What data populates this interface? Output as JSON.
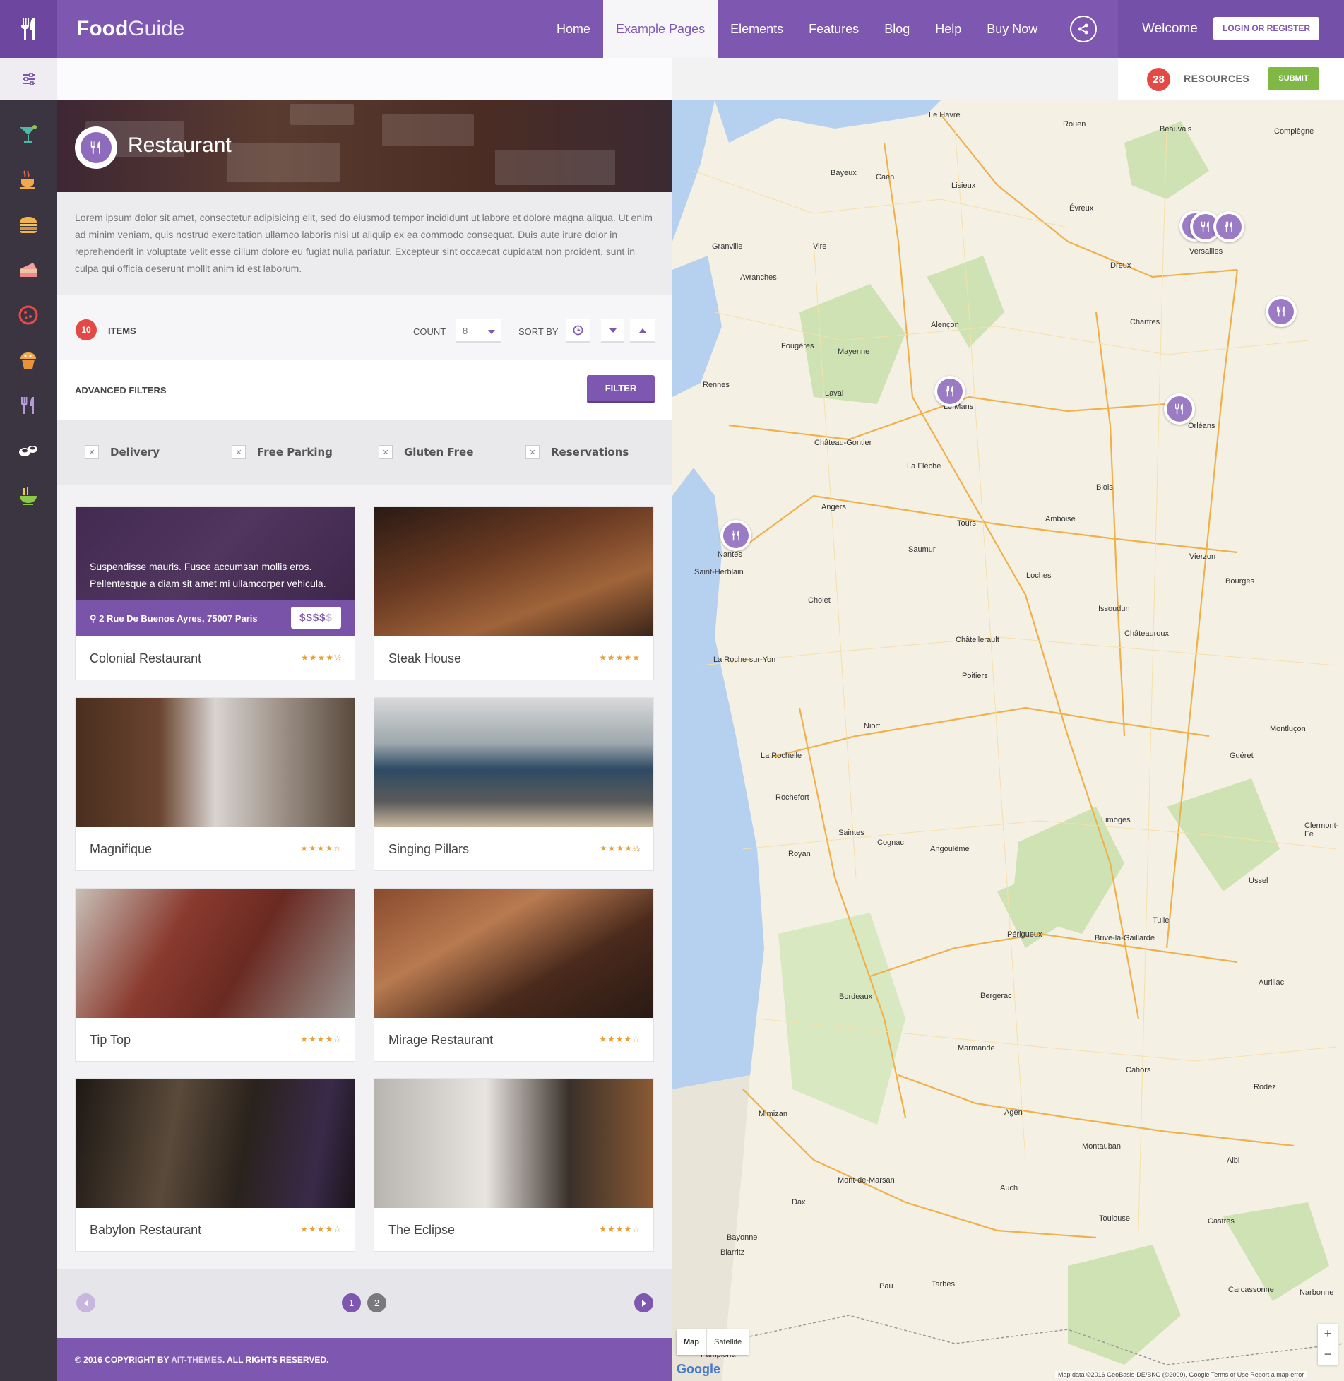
{
  "header": {
    "brand_bold": "Food",
    "brand_light": "Guide",
    "nav": [
      "Home",
      "Example Pages",
      "Elements",
      "Features",
      "Blog",
      "Help",
      "Buy Now"
    ],
    "active_nav": "Example Pages",
    "welcome": "Welcome",
    "login": "LOGIN OR REGISTER",
    "accent": "#7e57b0"
  },
  "resources": {
    "count": "28",
    "label": "RESOURCES",
    "submit": "SUBMIT"
  },
  "sidebar": {
    "icons": [
      "cocktail-icon",
      "coffee-icon",
      "burger-icon",
      "cake-icon",
      "pizza-icon",
      "muffin-icon",
      "restaurant-icon",
      "sushi-icon",
      "noodle-bowl-icon"
    ]
  },
  "hero": {
    "title": "Restaurant"
  },
  "description": "Lorem ipsum dolor sit amet, consectetur adipisicing elit, sed do eiusmod tempor incididunt ut labore et dolore magna aliqua. Ut enim ad minim veniam, quis nostrud exercitation ullamco laboris nisi ut aliquip ex ea commodo consequat. Duis aute irure dolor in reprehenderit in voluptate velit esse cillum dolore eu fugiat nulla pariatur. Excepteur sint occaecat cupidatat non proident, sunt in culpa qui officia deserunt mollit anim id est laborum.",
  "toolbar": {
    "items_count": "10",
    "items_label": "ITEMS",
    "count_label": "COUNT",
    "count_value": "8",
    "sort_label": "SORT BY"
  },
  "filters": {
    "advanced_label": "ADVANCED FILTERS",
    "filter_button": "FILTER",
    "options": [
      "Delivery",
      "Free Parking",
      "Gluten Free",
      "Reservations"
    ]
  },
  "featured": {
    "excerpt": "Suspendisse mauris. Fusce accumsan mollis eros. Pellentesque a diam sit amet mi ullamcorper vehicula.",
    "address": "2 Rue De Buenos Ayres, 75007 Paris",
    "price_on": "$$$$",
    "price_off": "$"
  },
  "cards": [
    {
      "name": "Colonial Restaurant",
      "stars": "★★★★½"
    },
    {
      "name": "Steak House",
      "stars": "★★★★★"
    },
    {
      "name": "Magnifique",
      "stars": "★★★★☆"
    },
    {
      "name": "Singing Pillars",
      "stars": "★★★★½"
    },
    {
      "name": "Tip Top",
      "stars": "★★★★☆"
    },
    {
      "name": "Mirage Restaurant",
      "stars": "★★★★☆"
    },
    {
      "name": "Babylon Restaurant",
      "stars": "★★★★☆"
    },
    {
      "name": "The Eclipse",
      "stars": "★★★★☆"
    }
  ],
  "pagination": {
    "pages": [
      "1",
      "2"
    ],
    "current": "1"
  },
  "footer": {
    "prefix": "© 2016 COPYRIGHT BY ",
    "link": "AIT-THEMES",
    "suffix": ". ALL RIGHTS RESERVED."
  },
  "map": {
    "cities": [
      "Le Havre",
      "Rouen",
      "Beauvais",
      "Compiègne",
      "Caen",
      "Bayeux",
      "Lisieux",
      "Évreux",
      "Versailles",
      "Dreux",
      "Chartres",
      "Alençon",
      "Rennes",
      "Laval",
      "Le Mans",
      "Orléans",
      "Blois",
      "Angers",
      "Tours",
      "Nantes",
      "Saumur",
      "Cholet",
      "Poitiers",
      "La Rochelle",
      "Rochefort",
      "Angoulême",
      "Limoges",
      "Bordeaux",
      "Périgueux",
      "Brive-la-Gaillarde",
      "Agen",
      "Montauban",
      "Toulouse",
      "Pau",
      "Tarbes",
      "Bayonne",
      "Biarritz",
      "Mont-de-Marsan",
      "Bourges",
      "Vierzon",
      "Châteauroux",
      "Clermont-Fe",
      "Cahors",
      "Rodez",
      "Albi",
      "Castres",
      "Carcassonne",
      "Narbonne",
      "Granville",
      "Avranches",
      "Vire",
      "Mayenne",
      "Fougères",
      "Château-Gontier",
      "La Flèche",
      "Niort",
      "Saintes",
      "Cognac",
      "Royan",
      "Tulle",
      "Aurillac",
      "Bergerac",
      "Marmande",
      "Auch",
      "Dax",
      "Mimizan",
      "Guéret",
      "Issoudun",
      "Montluçon",
      "Ussel",
      "La Roche-sur-Yon",
      "Châtellerault",
      "Amboise",
      "Loches",
      "Pamplona",
      "Saint-Herblain"
    ],
    "map_label": "Map",
    "satellite_label": "Satellite",
    "google": "Google",
    "attribution": "Map data ©2016 GeoBasis-DE/BKG (©2009), Google   Terms of Use   Report a map error"
  }
}
